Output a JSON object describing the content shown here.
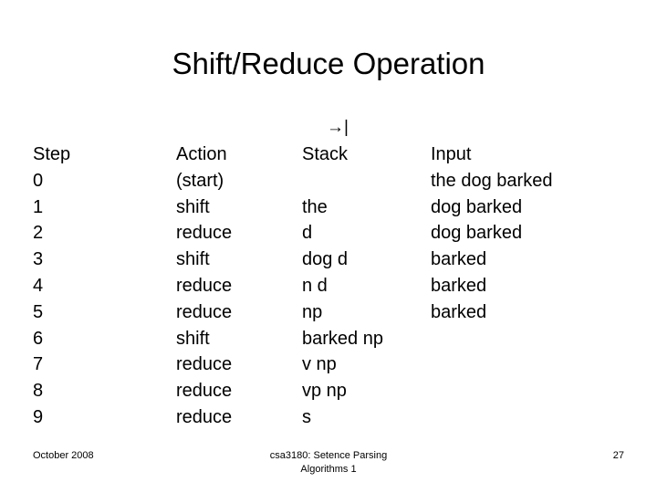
{
  "slide": {
    "title": "Shift/Reduce Operation",
    "arrow_marker": "→|",
    "table": {
      "headers": {
        "step": "Step",
        "action": "Action",
        "stack": "Stack",
        "input": "Input"
      },
      "rows": [
        {
          "step": "0",
          "action": "(start)",
          "stack": "",
          "input": "the dog barked"
        },
        {
          "step": "1",
          "action": "shift",
          "stack": "the",
          "input": "dog barked"
        },
        {
          "step": "2",
          "action": "reduce",
          "stack": "d",
          "input": "dog barked"
        },
        {
          "step": "3",
          "action": "shift",
          "stack": "dog d",
          "input": "barked"
        },
        {
          "step": "4",
          "action": "reduce",
          "stack": "n d",
          "input": "barked"
        },
        {
          "step": "5",
          "action": "reduce",
          "stack": "np",
          "input": "barked"
        },
        {
          "step": "6",
          "action": "shift",
          "stack": "barked np",
          "input": ""
        },
        {
          "step": "7",
          "action": "reduce",
          "stack": "v np",
          "input": ""
        },
        {
          "step": "8",
          "action": "reduce",
          "stack": "vp np",
          "input": ""
        },
        {
          "step": "9",
          "action": "reduce",
          "stack": "s",
          "input": ""
        }
      ]
    },
    "footer": {
      "date": "October 2008",
      "course": "csa3180: Setence Parsing\nAlgorithms 1",
      "page_number": "27"
    }
  },
  "colors": {
    "background": "#ffffff",
    "text": "#000000"
  }
}
